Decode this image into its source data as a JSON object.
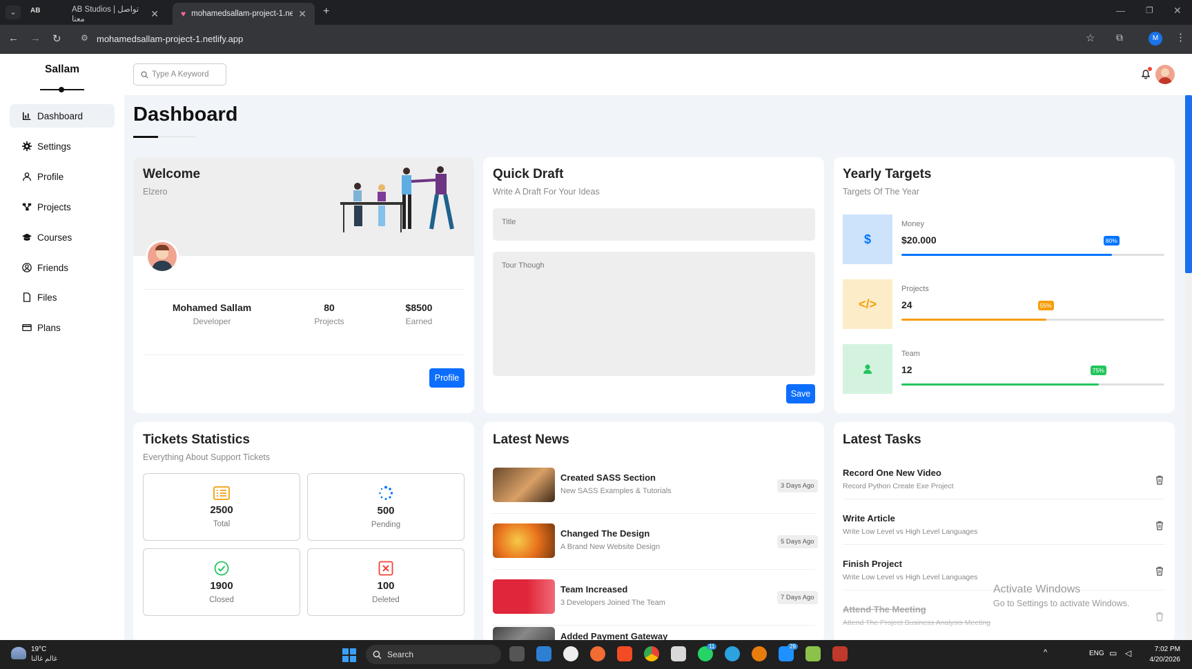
{
  "browser": {
    "tabs": [
      {
        "label": "AB Studios | تواصل معنا"
      },
      {
        "label": "mohamedsallam-project-1.netli"
      }
    ],
    "url": "mohamedsallam-project-1.netlify.app",
    "profile_initial": "M"
  },
  "sidebar": {
    "logo": "Sallam",
    "items": [
      {
        "label": "Dashboard",
        "icon": "chart-icon"
      },
      {
        "label": "Settings",
        "icon": "gear-icon"
      },
      {
        "label": "Profile",
        "icon": "user-icon"
      },
      {
        "label": "Projects",
        "icon": "diagram-icon"
      },
      {
        "label": "Courses",
        "icon": "graduation-cap-icon"
      },
      {
        "label": "Friends",
        "icon": "circle-user-icon"
      },
      {
        "label": "Files",
        "icon": "file-icon"
      },
      {
        "label": "Plans",
        "icon": "credit-card-icon"
      }
    ]
  },
  "header": {
    "search_placeholder": "Type A Keyword"
  },
  "page": {
    "title": "Dashboard"
  },
  "welcome": {
    "title": "Welcome",
    "subtitle": "Elzero",
    "name": "Mohamed Sallam",
    "role": "Developer",
    "projects_value": "80",
    "projects_label": "Projects",
    "earned_value": "$8500",
    "earned_label": "Earned",
    "button": "Profile"
  },
  "quick_draft": {
    "title": "Quick Draft",
    "subtitle": "Write A Draft For Your Ideas",
    "title_placeholder": "Title",
    "body_placeholder": "Tour Though",
    "button": "Save"
  },
  "yearly_targets": {
    "title": "Yearly Targets",
    "subtitle": "Targets Of The Year",
    "items": [
      {
        "label": "Money",
        "value": "$20.000",
        "percent": 80,
        "percent_label": "80%",
        "icon": "$",
        "color": "#0075ff",
        "bg": "#cde3fb"
      },
      {
        "label": "Projects",
        "value": "24",
        "percent": 55,
        "percent_label": "55%",
        "icon": "</>",
        "color": "#f59e0b",
        "bg": "#fdecc8"
      },
      {
        "label": "Team",
        "value": "12",
        "percent": 75,
        "percent_label": "75%",
        "icon": "user-icon",
        "color": "#22c55e",
        "bg": "#d3f3df"
      }
    ]
  },
  "tickets": {
    "title": "Tickets Statistics",
    "subtitle": "Everything About Support Tickets",
    "stats": [
      {
        "value": "2500",
        "label": "Total",
        "icon": "list-icon",
        "color": "#f59e0b"
      },
      {
        "value": "500",
        "label": "Pending",
        "icon": "spinner-icon",
        "color": "#0075ff"
      },
      {
        "value": "1900",
        "label": "Closed",
        "icon": "check-circle-icon",
        "color": "#22c55e"
      },
      {
        "value": "100",
        "label": "Deleted",
        "icon": "x-square-icon",
        "color": "#f44336"
      }
    ]
  },
  "news": {
    "title": "Latest News",
    "items": [
      {
        "title": "Created SASS Section",
        "sub": "New SASS Examples & Tutorials",
        "date": "3 Days Ago"
      },
      {
        "title": "Changed The Design",
        "sub": "A Brand New Website Design",
        "date": "5 Days Ago"
      },
      {
        "title": "Team Increased",
        "sub": "3 Developers Joined The Team",
        "date": "7 Days Ago"
      },
      {
        "title": "Added Payment Gateway",
        "sub": "",
        "date": ""
      }
    ]
  },
  "tasks": {
    "title": "Latest Tasks",
    "items": [
      {
        "title": "Record One New Video",
        "sub": "Record Python Create Exe Project"
      },
      {
        "title": "Write Article",
        "sub": "Write Low Level vs High Level Languages"
      },
      {
        "title": "Finish Project",
        "sub": "Write Low Level vs High Level Languages"
      },
      {
        "title": "Attend The Meeting",
        "sub": "Attend The Project Business Analysis Meeting"
      }
    ]
  },
  "activate": {
    "title": "Activate Windows",
    "sub": "Go to Settings to activate Windows."
  },
  "taskbar": {
    "weather_temp": "19°C",
    "weather_text": "غالم غالنا",
    "search_label": "Search",
    "lang": "ENG",
    "time": "7:02 PM",
    "date": "4/20/2026",
    "badges": [
      "11",
      "29"
    ]
  }
}
